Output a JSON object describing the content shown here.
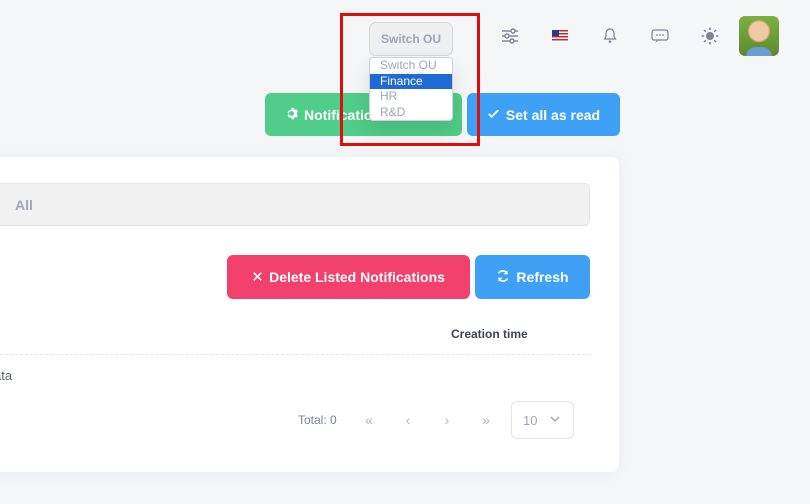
{
  "header": {
    "switch_ou_label": "Switch OU",
    "ou_dropdown": {
      "options": [
        "Switch OU",
        "Finance",
        "HR",
        "R&D"
      ],
      "selected": "Finance"
    },
    "icons": [
      "sliders-icon",
      "us-flag-icon",
      "bell-icon",
      "chat-icon",
      "sun-icon"
    ]
  },
  "actions": {
    "notification_settings_label": "Notifications",
    "set_all_read_label": "Set all as read"
  },
  "filter": {
    "select_value": "All"
  },
  "toolbar": {
    "delete_label": "Delete Listed Notifications",
    "refresh_label": "Refresh"
  },
  "table": {
    "columns": [
      "Creation time"
    ],
    "empty_text": "ata"
  },
  "pagination": {
    "total_label": "Total: 0",
    "page_size": "10"
  },
  "colors": {
    "green": "#50cd89",
    "blue": "#3ea1f5",
    "red": "#f1416c",
    "highlight": "#e00d0d"
  }
}
